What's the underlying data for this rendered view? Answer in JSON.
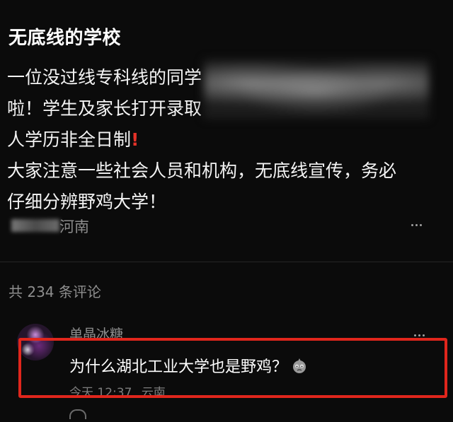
{
  "post": {
    "title": "无底线的学校",
    "body_lines": [
      "一位没过线专科线的同学",
      "啦！学生及家长打开录取",
      "人学历非全日制",
      "大家注意一些社会人员和机构，无底线宣传，务必",
      "仔细分辨野鸡大学！"
    ],
    "warning_mark": "!",
    "location": "河南"
  },
  "comments": {
    "count_label": "共 234 条评论",
    "items": [
      {
        "username": "单晶冰糖",
        "text": "为什么湖北工业大学也是野鸡？",
        "sticker_icon": "sad-face-sticker-icon",
        "time": "今天 12:37",
        "location": "云南"
      }
    ]
  },
  "colors": {
    "background": "#0b0b0b",
    "text": "#f4f4f4",
    "secondary_text": "#8e8e8e",
    "highlight_border": "#e0261c",
    "warning": "#e53228"
  }
}
